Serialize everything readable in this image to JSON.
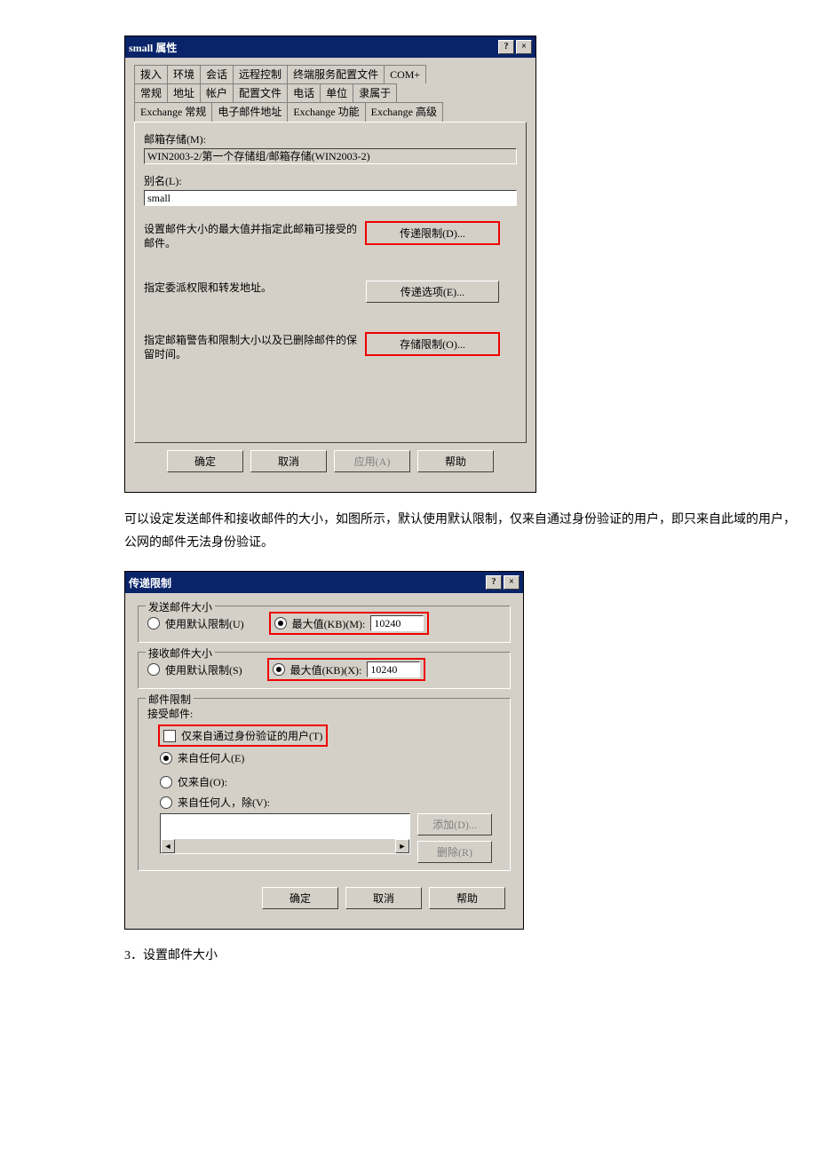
{
  "dialog1": {
    "title": "small 属性",
    "help_btn": "?",
    "close_btn": "×",
    "tabs_row1": [
      "拨入",
      "环境",
      "会话",
      "远程控制",
      "终端服务配置文件",
      "COM+"
    ],
    "tabs_row2": [
      "常规",
      "地址",
      "帐户",
      "配置文件",
      "电话",
      "单位",
      "隶属于"
    ],
    "tabs_row3": [
      "Exchange 常规",
      "电子邮件地址",
      "Exchange 功能",
      "Exchange 高级"
    ],
    "mailbox_store_label": "邮箱存储(M):",
    "mailbox_store_value": "WIN2003-2/第一个存储组/邮箱存储(WIN2003-2)",
    "alias_label": "别名(L):",
    "alias_value": "small",
    "desc1": "设置邮件大小的最大值并指定此邮箱可接受的邮件。",
    "btn1": "传递限制(D)...",
    "desc2": "指定委派权限和转发地址。",
    "btn2": "传递选项(E)...",
    "desc3": "指定邮箱警告和限制大小以及已删除邮件的保留时间。",
    "btn3": "存储限制(O)...",
    "ok": "确定",
    "cancel": "取消",
    "apply": "应用(A)",
    "help": "帮助"
  },
  "paragraph1": "可以设定发送邮件和接收邮件的大小，如图所示，默认使用默认限制，仅来自通过身份验证的用户，即只来自此域的用户，公网的邮件无法身份验证。",
  "dialog2": {
    "title": "传递限制",
    "help_btn": "?",
    "close_btn": "×",
    "group_send": "发送邮件大小",
    "send_default": "使用默认限制(U)",
    "send_max_label": "最大值(KB)(M):",
    "send_max_value": "10240",
    "group_recv": "接收邮件大小",
    "recv_default": "使用默认限制(S)",
    "recv_max_label": "最大值(KB)(X):",
    "recv_max_value": "10240",
    "group_restrict": "邮件限制",
    "accept_label": "接受邮件:",
    "chk_auth": "仅来自通过身份验证的用户(T)",
    "opt_everyone": "来自任何人(E)",
    "opt_only": "仅来自(O):",
    "opt_except": "来自任何人，除(V):",
    "add": "添加(D)...",
    "remove": "删除(R)",
    "ok": "确定",
    "cancel": "取消",
    "help": "帮助"
  },
  "section3": "3．设置邮件大小"
}
